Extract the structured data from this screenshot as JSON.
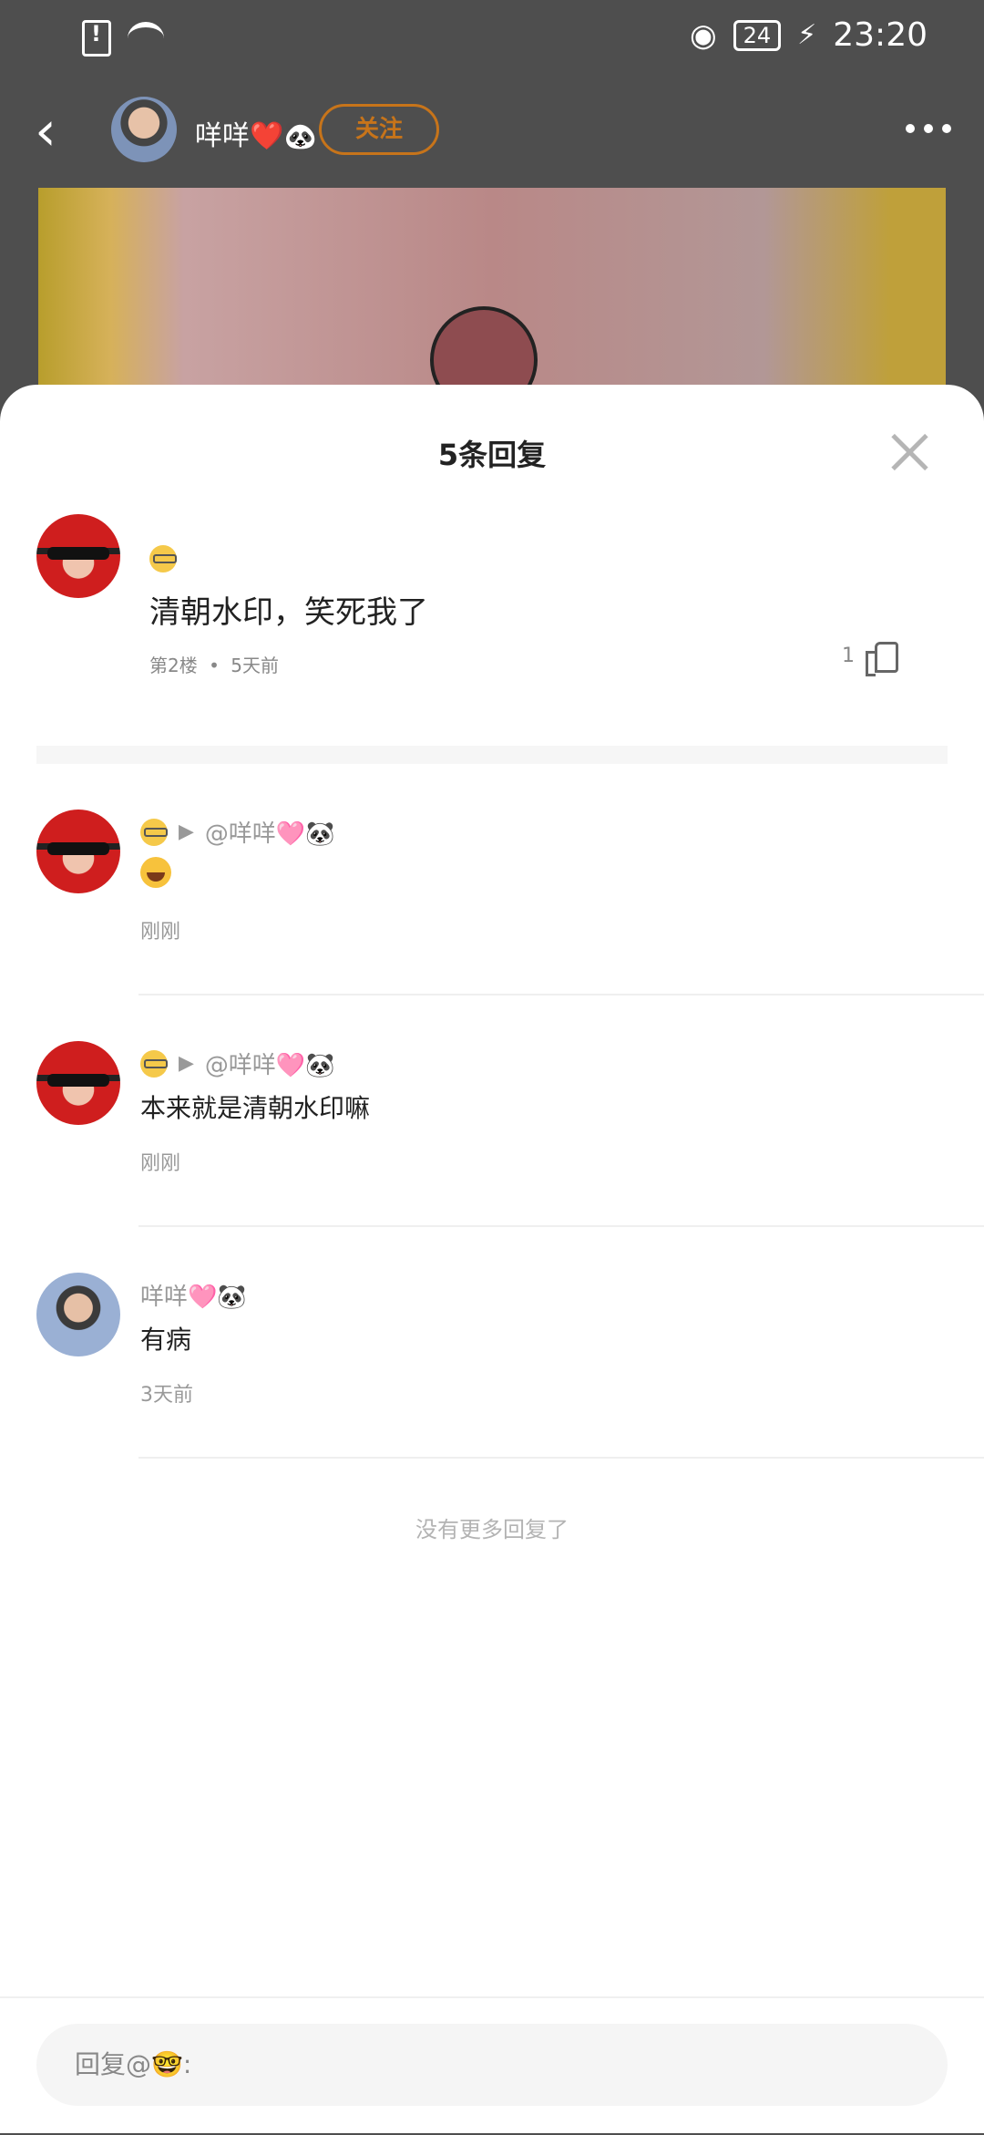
{
  "status_bar": {
    "battery": "24",
    "time": "23:20"
  },
  "post_header": {
    "author_name": "咩咩❤️🐼",
    "follow_label": "关注"
  },
  "sheet": {
    "title": "5条回复"
  },
  "main_comment": {
    "content": "清朝水印，笑死我了",
    "floor": "第2楼",
    "separator": "•",
    "time": "5天前",
    "likes": "1"
  },
  "replies": [
    {
      "target": "@咩咩🩷🐼",
      "content": "",
      "time": "刚刚"
    },
    {
      "target": "@咩咩🩷🐼",
      "content": "本来就是清朝水印嘛",
      "time": "刚刚"
    },
    {
      "author": "咩咩🩷🐼",
      "content": "有病",
      "time": "3天前"
    }
  ],
  "footer": {
    "no_more": "没有更多回复了",
    "reply_placeholder": "回复@🤓:"
  }
}
